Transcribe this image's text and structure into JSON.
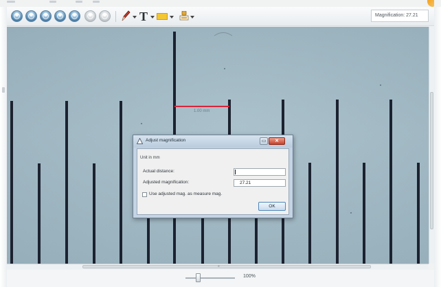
{
  "toolbar": {
    "buttons": [
      {
        "icon": "zoom-in-icon",
        "style": "blue"
      },
      {
        "icon": "zoom-out-icon",
        "style": "blue"
      },
      {
        "icon": "rotate-left-icon",
        "style": "blue"
      },
      {
        "icon": "rotate-right-icon",
        "style": "blue"
      },
      {
        "icon": "fit-window-icon",
        "style": "blue"
      },
      {
        "icon": "previous-icon",
        "style": "grey"
      },
      {
        "icon": "next-icon",
        "style": "grey"
      }
    ],
    "tools": [
      "pencil-icon",
      "text-tool-icon",
      "highlight-icon",
      "stamp-icon"
    ],
    "magnification_label": "Magnification: 27.21"
  },
  "viewport": {
    "measurement_label": "1.00 mm"
  },
  "zoom": {
    "value": "100%",
    "fraction": 0.25
  },
  "dialog": {
    "title": "Adjust magnification",
    "close_label": "✕",
    "minimize_label": "▭",
    "section": "Unit in mm",
    "actual_distance_label": "Actual distance:",
    "actual_distance_value": "",
    "adjusted_magnification_label": "Adjusted magnification:",
    "adjusted_magnification_value": "27.21",
    "checkbox_label": "Use adjusted mag. as measure mag.",
    "checkbox_checked": false,
    "ok_label": "OK"
  },
  "colors": {
    "measure_line": "#d8243a",
    "specimen_background": "#a3bcc7",
    "tick_marks": "#1c2230",
    "close_button": "#c9402a",
    "highlight_tool": "#f3c633"
  }
}
